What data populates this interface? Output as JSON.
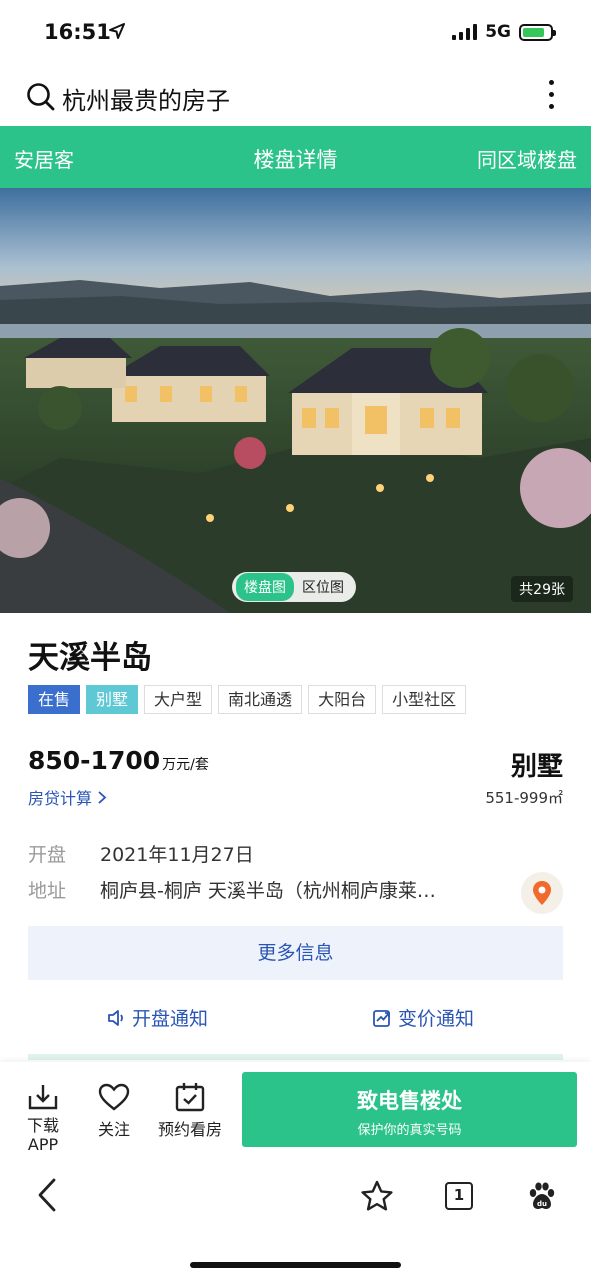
{
  "status": {
    "time": "16:51",
    "network": "5G"
  },
  "search": {
    "query": "杭州最贵的房子"
  },
  "nav": {
    "left": "安居客",
    "center": "楼盘详情",
    "right": "同区域楼盘"
  },
  "gallery": {
    "tab_active": "楼盘图",
    "tab_inactive": "区位图",
    "count": "共29张"
  },
  "property": {
    "name": "天溪半岛",
    "tags": [
      "在售",
      "别墅",
      "大户型",
      "南北通透",
      "大阳台",
      "小型社区"
    ],
    "price": "850-1700",
    "price_unit": "万元/套",
    "loan_link": "房贷计算",
    "type": "别墅",
    "area": "551-999㎡",
    "open_label": "开盘",
    "open_date": "2021年11月27日",
    "addr_label": "地址",
    "address": "桐庐县-桐庐 天溪半岛（杭州桐庐康莱…"
  },
  "more_info": "更多信息",
  "notify": {
    "open": "开盘通知",
    "price": "变价通知"
  },
  "actions": {
    "download_1": "下载",
    "download_2": "APP",
    "follow": "关注",
    "book": "预约看房",
    "call_title": "致电售楼处",
    "call_sub": "保护你的真实号码"
  },
  "browser": {
    "tab_count": "1"
  },
  "colors": {
    "brand": "#2bc38a",
    "link": "#2a55b5",
    "tag_sale": "#3a6fce",
    "tag_villa": "#5ec8d4"
  }
}
